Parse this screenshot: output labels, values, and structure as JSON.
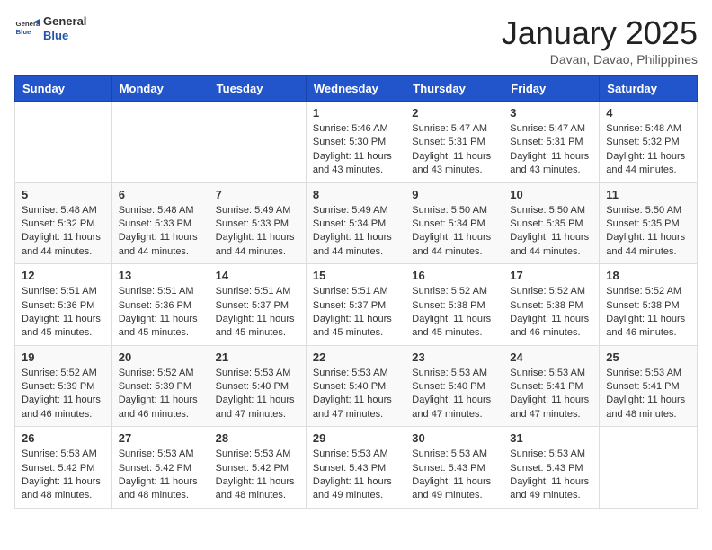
{
  "header": {
    "logo_general": "General",
    "logo_blue": "Blue",
    "month_title": "January 2025",
    "location": "Davan, Davao, Philippines"
  },
  "days_of_week": [
    "Sunday",
    "Monday",
    "Tuesday",
    "Wednesday",
    "Thursday",
    "Friday",
    "Saturday"
  ],
  "weeks": [
    [
      {
        "day": "",
        "info": ""
      },
      {
        "day": "",
        "info": ""
      },
      {
        "day": "",
        "info": ""
      },
      {
        "day": "1",
        "sunrise": "5:46 AM",
        "sunset": "5:30 PM",
        "daylight": "11 hours and 43 minutes."
      },
      {
        "day": "2",
        "sunrise": "5:47 AM",
        "sunset": "5:31 PM",
        "daylight": "11 hours and 43 minutes."
      },
      {
        "day": "3",
        "sunrise": "5:47 AM",
        "sunset": "5:31 PM",
        "daylight": "11 hours and 43 minutes."
      },
      {
        "day": "4",
        "sunrise": "5:48 AM",
        "sunset": "5:32 PM",
        "daylight": "11 hours and 44 minutes."
      }
    ],
    [
      {
        "day": "5",
        "sunrise": "5:48 AM",
        "sunset": "5:32 PM",
        "daylight": "11 hours and 44 minutes."
      },
      {
        "day": "6",
        "sunrise": "5:48 AM",
        "sunset": "5:33 PM",
        "daylight": "11 hours and 44 minutes."
      },
      {
        "day": "7",
        "sunrise": "5:49 AM",
        "sunset": "5:33 PM",
        "daylight": "11 hours and 44 minutes."
      },
      {
        "day": "8",
        "sunrise": "5:49 AM",
        "sunset": "5:34 PM",
        "daylight": "11 hours and 44 minutes."
      },
      {
        "day": "9",
        "sunrise": "5:50 AM",
        "sunset": "5:34 PM",
        "daylight": "11 hours and 44 minutes."
      },
      {
        "day": "10",
        "sunrise": "5:50 AM",
        "sunset": "5:35 PM",
        "daylight": "11 hours and 44 minutes."
      },
      {
        "day": "11",
        "sunrise": "5:50 AM",
        "sunset": "5:35 PM",
        "daylight": "11 hours and 44 minutes."
      }
    ],
    [
      {
        "day": "12",
        "sunrise": "5:51 AM",
        "sunset": "5:36 PM",
        "daylight": "11 hours and 45 minutes."
      },
      {
        "day": "13",
        "sunrise": "5:51 AM",
        "sunset": "5:36 PM",
        "daylight": "11 hours and 45 minutes."
      },
      {
        "day": "14",
        "sunrise": "5:51 AM",
        "sunset": "5:37 PM",
        "daylight": "11 hours and 45 minutes."
      },
      {
        "day": "15",
        "sunrise": "5:51 AM",
        "sunset": "5:37 PM",
        "daylight": "11 hours and 45 minutes."
      },
      {
        "day": "16",
        "sunrise": "5:52 AM",
        "sunset": "5:38 PM",
        "daylight": "11 hours and 45 minutes."
      },
      {
        "day": "17",
        "sunrise": "5:52 AM",
        "sunset": "5:38 PM",
        "daylight": "11 hours and 46 minutes."
      },
      {
        "day": "18",
        "sunrise": "5:52 AM",
        "sunset": "5:38 PM",
        "daylight": "11 hours and 46 minutes."
      }
    ],
    [
      {
        "day": "19",
        "sunrise": "5:52 AM",
        "sunset": "5:39 PM",
        "daylight": "11 hours and 46 minutes."
      },
      {
        "day": "20",
        "sunrise": "5:52 AM",
        "sunset": "5:39 PM",
        "daylight": "11 hours and 46 minutes."
      },
      {
        "day": "21",
        "sunrise": "5:53 AM",
        "sunset": "5:40 PM",
        "daylight": "11 hours and 47 minutes."
      },
      {
        "day": "22",
        "sunrise": "5:53 AM",
        "sunset": "5:40 PM",
        "daylight": "11 hours and 47 minutes."
      },
      {
        "day": "23",
        "sunrise": "5:53 AM",
        "sunset": "5:40 PM",
        "daylight": "11 hours and 47 minutes."
      },
      {
        "day": "24",
        "sunrise": "5:53 AM",
        "sunset": "5:41 PM",
        "daylight": "11 hours and 47 minutes."
      },
      {
        "day": "25",
        "sunrise": "5:53 AM",
        "sunset": "5:41 PM",
        "daylight": "11 hours and 48 minutes."
      }
    ],
    [
      {
        "day": "26",
        "sunrise": "5:53 AM",
        "sunset": "5:42 PM",
        "daylight": "11 hours and 48 minutes."
      },
      {
        "day": "27",
        "sunrise": "5:53 AM",
        "sunset": "5:42 PM",
        "daylight": "11 hours and 48 minutes."
      },
      {
        "day": "28",
        "sunrise": "5:53 AM",
        "sunset": "5:42 PM",
        "daylight": "11 hours and 48 minutes."
      },
      {
        "day": "29",
        "sunrise": "5:53 AM",
        "sunset": "5:43 PM",
        "daylight": "11 hours and 49 minutes."
      },
      {
        "day": "30",
        "sunrise": "5:53 AM",
        "sunset": "5:43 PM",
        "daylight": "11 hours and 49 minutes."
      },
      {
        "day": "31",
        "sunrise": "5:53 AM",
        "sunset": "5:43 PM",
        "daylight": "11 hours and 49 minutes."
      },
      {
        "day": "",
        "info": ""
      }
    ]
  ],
  "labels": {
    "sunrise": "Sunrise:",
    "sunset": "Sunset:",
    "daylight": "Daylight:"
  }
}
